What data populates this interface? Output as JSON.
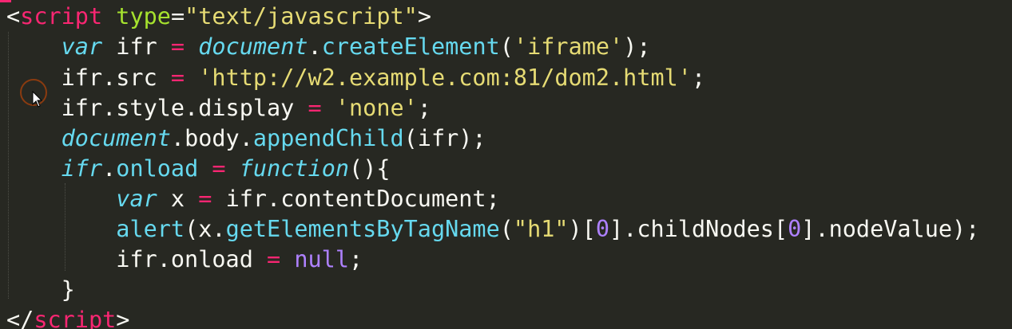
{
  "editor": {
    "theme_colors": {
      "background": "#272822",
      "default": "#f8f8f2",
      "tag": "#f92672",
      "string": "#e6db74",
      "attribute": "#a6e22e",
      "keyword": "#66d9ef",
      "number": "#ae81ff"
    },
    "lines": [
      [
        {
          "t": "<",
          "c": "punc"
        },
        {
          "t": "script",
          "c": "tag"
        },
        {
          "t": " ",
          "c": "punc"
        },
        {
          "t": "type",
          "c": "attr"
        },
        {
          "t": "=",
          "c": "punc"
        },
        {
          "t": "\"text/javascript\"",
          "c": "str"
        },
        {
          "t": ">",
          "c": "punc"
        }
      ],
      [
        {
          "t": "    ",
          "c": "punc"
        },
        {
          "t": "var",
          "c": "kw"
        },
        {
          "t": " ifr ",
          "c": "punc"
        },
        {
          "t": "=",
          "c": "op"
        },
        {
          "t": " ",
          "c": "punc"
        },
        {
          "t": "document",
          "c": "ital"
        },
        {
          "t": ".",
          "c": "punc"
        },
        {
          "t": "createElement",
          "c": "fn"
        },
        {
          "t": "(",
          "c": "punc"
        },
        {
          "t": "'iframe'",
          "c": "str"
        },
        {
          "t": ");",
          "c": "punc"
        }
      ],
      [
        {
          "t": "    ifr.src ",
          "c": "punc"
        },
        {
          "t": "=",
          "c": "op"
        },
        {
          "t": " ",
          "c": "punc"
        },
        {
          "t": "'http://w2.example.com:81/dom2.html'",
          "c": "str"
        },
        {
          "t": ";",
          "c": "punc"
        }
      ],
      [
        {
          "t": "    ifr.style.display ",
          "c": "punc"
        },
        {
          "t": "=",
          "c": "op"
        },
        {
          "t": " ",
          "c": "punc"
        },
        {
          "t": "'none'",
          "c": "str"
        },
        {
          "t": ";",
          "c": "punc"
        }
      ],
      [
        {
          "t": "    ",
          "c": "punc"
        },
        {
          "t": "document",
          "c": "ital"
        },
        {
          "t": ".body.",
          "c": "punc"
        },
        {
          "t": "appendChild",
          "c": "fn"
        },
        {
          "t": "(ifr);",
          "c": "punc"
        }
      ],
      [
        {
          "t": "    ",
          "c": "punc"
        },
        {
          "t": "ifr",
          "c": "ital"
        },
        {
          "t": ".",
          "c": "punc"
        },
        {
          "t": "onload",
          "c": "fn"
        },
        {
          "t": " ",
          "c": "punc"
        },
        {
          "t": "=",
          "c": "op"
        },
        {
          "t": " ",
          "c": "punc"
        },
        {
          "t": "function",
          "c": "kw"
        },
        {
          "t": "(){",
          "c": "punc"
        }
      ],
      [
        {
          "t": "        ",
          "c": "punc"
        },
        {
          "t": "var",
          "c": "kw"
        },
        {
          "t": " x ",
          "c": "punc"
        },
        {
          "t": "=",
          "c": "op"
        },
        {
          "t": " ifr.contentDocument;",
          "c": "punc"
        }
      ],
      [
        {
          "t": "        ",
          "c": "punc"
        },
        {
          "t": "alert",
          "c": "fn"
        },
        {
          "t": "(x.",
          "c": "punc"
        },
        {
          "t": "getElementsByTagName",
          "c": "fn"
        },
        {
          "t": "(",
          "c": "punc"
        },
        {
          "t": "\"h1\"",
          "c": "str"
        },
        {
          "t": ")[",
          "c": "punc"
        },
        {
          "t": "0",
          "c": "num"
        },
        {
          "t": "].childNodes[",
          "c": "punc"
        },
        {
          "t": "0",
          "c": "num"
        },
        {
          "t": "].nodeValue);",
          "c": "punc"
        }
      ],
      [
        {
          "t": "        ifr.onload ",
          "c": "punc"
        },
        {
          "t": "=",
          "c": "op"
        },
        {
          "t": " ",
          "c": "punc"
        },
        {
          "t": "null",
          "c": "num"
        },
        {
          "t": ";",
          "c": "punc"
        }
      ],
      [
        {
          "t": "    }",
          "c": "punc"
        }
      ],
      [
        {
          "t": "</",
          "c": "punc"
        },
        {
          "t": "script",
          "c": "tag"
        },
        {
          "t": ">",
          "c": "punc"
        }
      ]
    ]
  },
  "cursor": {
    "icon": "mouse-pointer-icon"
  }
}
